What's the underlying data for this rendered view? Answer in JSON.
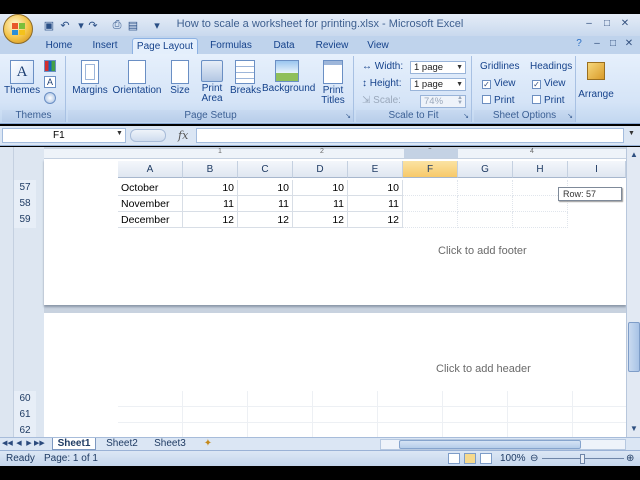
{
  "window": {
    "title": "How to scale a worksheet for printing.xlsx - Microsoft Excel",
    "minimize": "–",
    "restore": "□",
    "close": "✕"
  },
  "qat": [
    {
      "name": "save-icon",
      "glyph": "▣"
    },
    {
      "name": "undo-icon",
      "glyph": "↶"
    },
    {
      "name": "redo-icon",
      "glyph": "↷"
    },
    {
      "name": "print-preview-icon",
      "glyph": "⎙"
    },
    {
      "name": "quick-print-icon",
      "glyph": "▤"
    },
    {
      "name": "qat-dropdown-icon",
      "glyph": "▾"
    }
  ],
  "tabs": [
    "Home",
    "Insert",
    "Page Layout",
    "Formulas",
    "Data",
    "Review",
    "View"
  ],
  "active_tab": "Page Layout",
  "ribbon": {
    "themes": {
      "label": "Themes",
      "button": "Themes"
    },
    "page_setup": {
      "label": "Page Setup",
      "buttons": [
        "Margins",
        "Orientation",
        "Size",
        "Print Area",
        "Breaks",
        "Background",
        "Print Titles"
      ]
    },
    "scale_to_fit": {
      "label": "Scale to Fit",
      "width_label": "Width:",
      "width_value": "1 page",
      "height_label": "Height:",
      "height_value": "1 page",
      "scale_label": "Scale:",
      "scale_value": "74%"
    },
    "sheet_options": {
      "label": "Sheet Options",
      "gridlines": "Gridlines",
      "headings": "Headings",
      "view": "View",
      "print": "Print"
    },
    "arrange": {
      "label": "Arrange"
    }
  },
  "formula_bar": {
    "name_box": "F1",
    "fx": "fx",
    "value": ""
  },
  "columns": [
    "A",
    "B",
    "C",
    "D",
    "E",
    "F",
    "G",
    "H",
    "I"
  ],
  "selected_column": "F",
  "ruler_marks": [
    "1",
    "2",
    "3",
    "4"
  ],
  "rows": [
    {
      "num": "57",
      "cells": [
        "October",
        "10",
        "10",
        "10",
        "10"
      ]
    },
    {
      "num": "58",
      "cells": [
        "November",
        "11",
        "11",
        "11",
        "11"
      ]
    },
    {
      "num": "59",
      "cells": [
        "December",
        "12",
        "12",
        "12",
        "12"
      ]
    }
  ],
  "lower_rows": [
    "60",
    "61",
    "62"
  ],
  "footer_prompt": "Click to add footer",
  "header_prompt": "Click to add header",
  "row_tooltip": "Row: 57",
  "sheet_tabs": [
    "Sheet1",
    "Sheet2",
    "Sheet3"
  ],
  "active_sheet": "Sheet1",
  "status": {
    "ready": "Ready",
    "page": "Page: 1 of 1",
    "zoom": "100%"
  },
  "colors": {
    "accent": "#15428b",
    "ribbon_bg": "#dbe7f6",
    "selected_col": "#f7c96a"
  }
}
